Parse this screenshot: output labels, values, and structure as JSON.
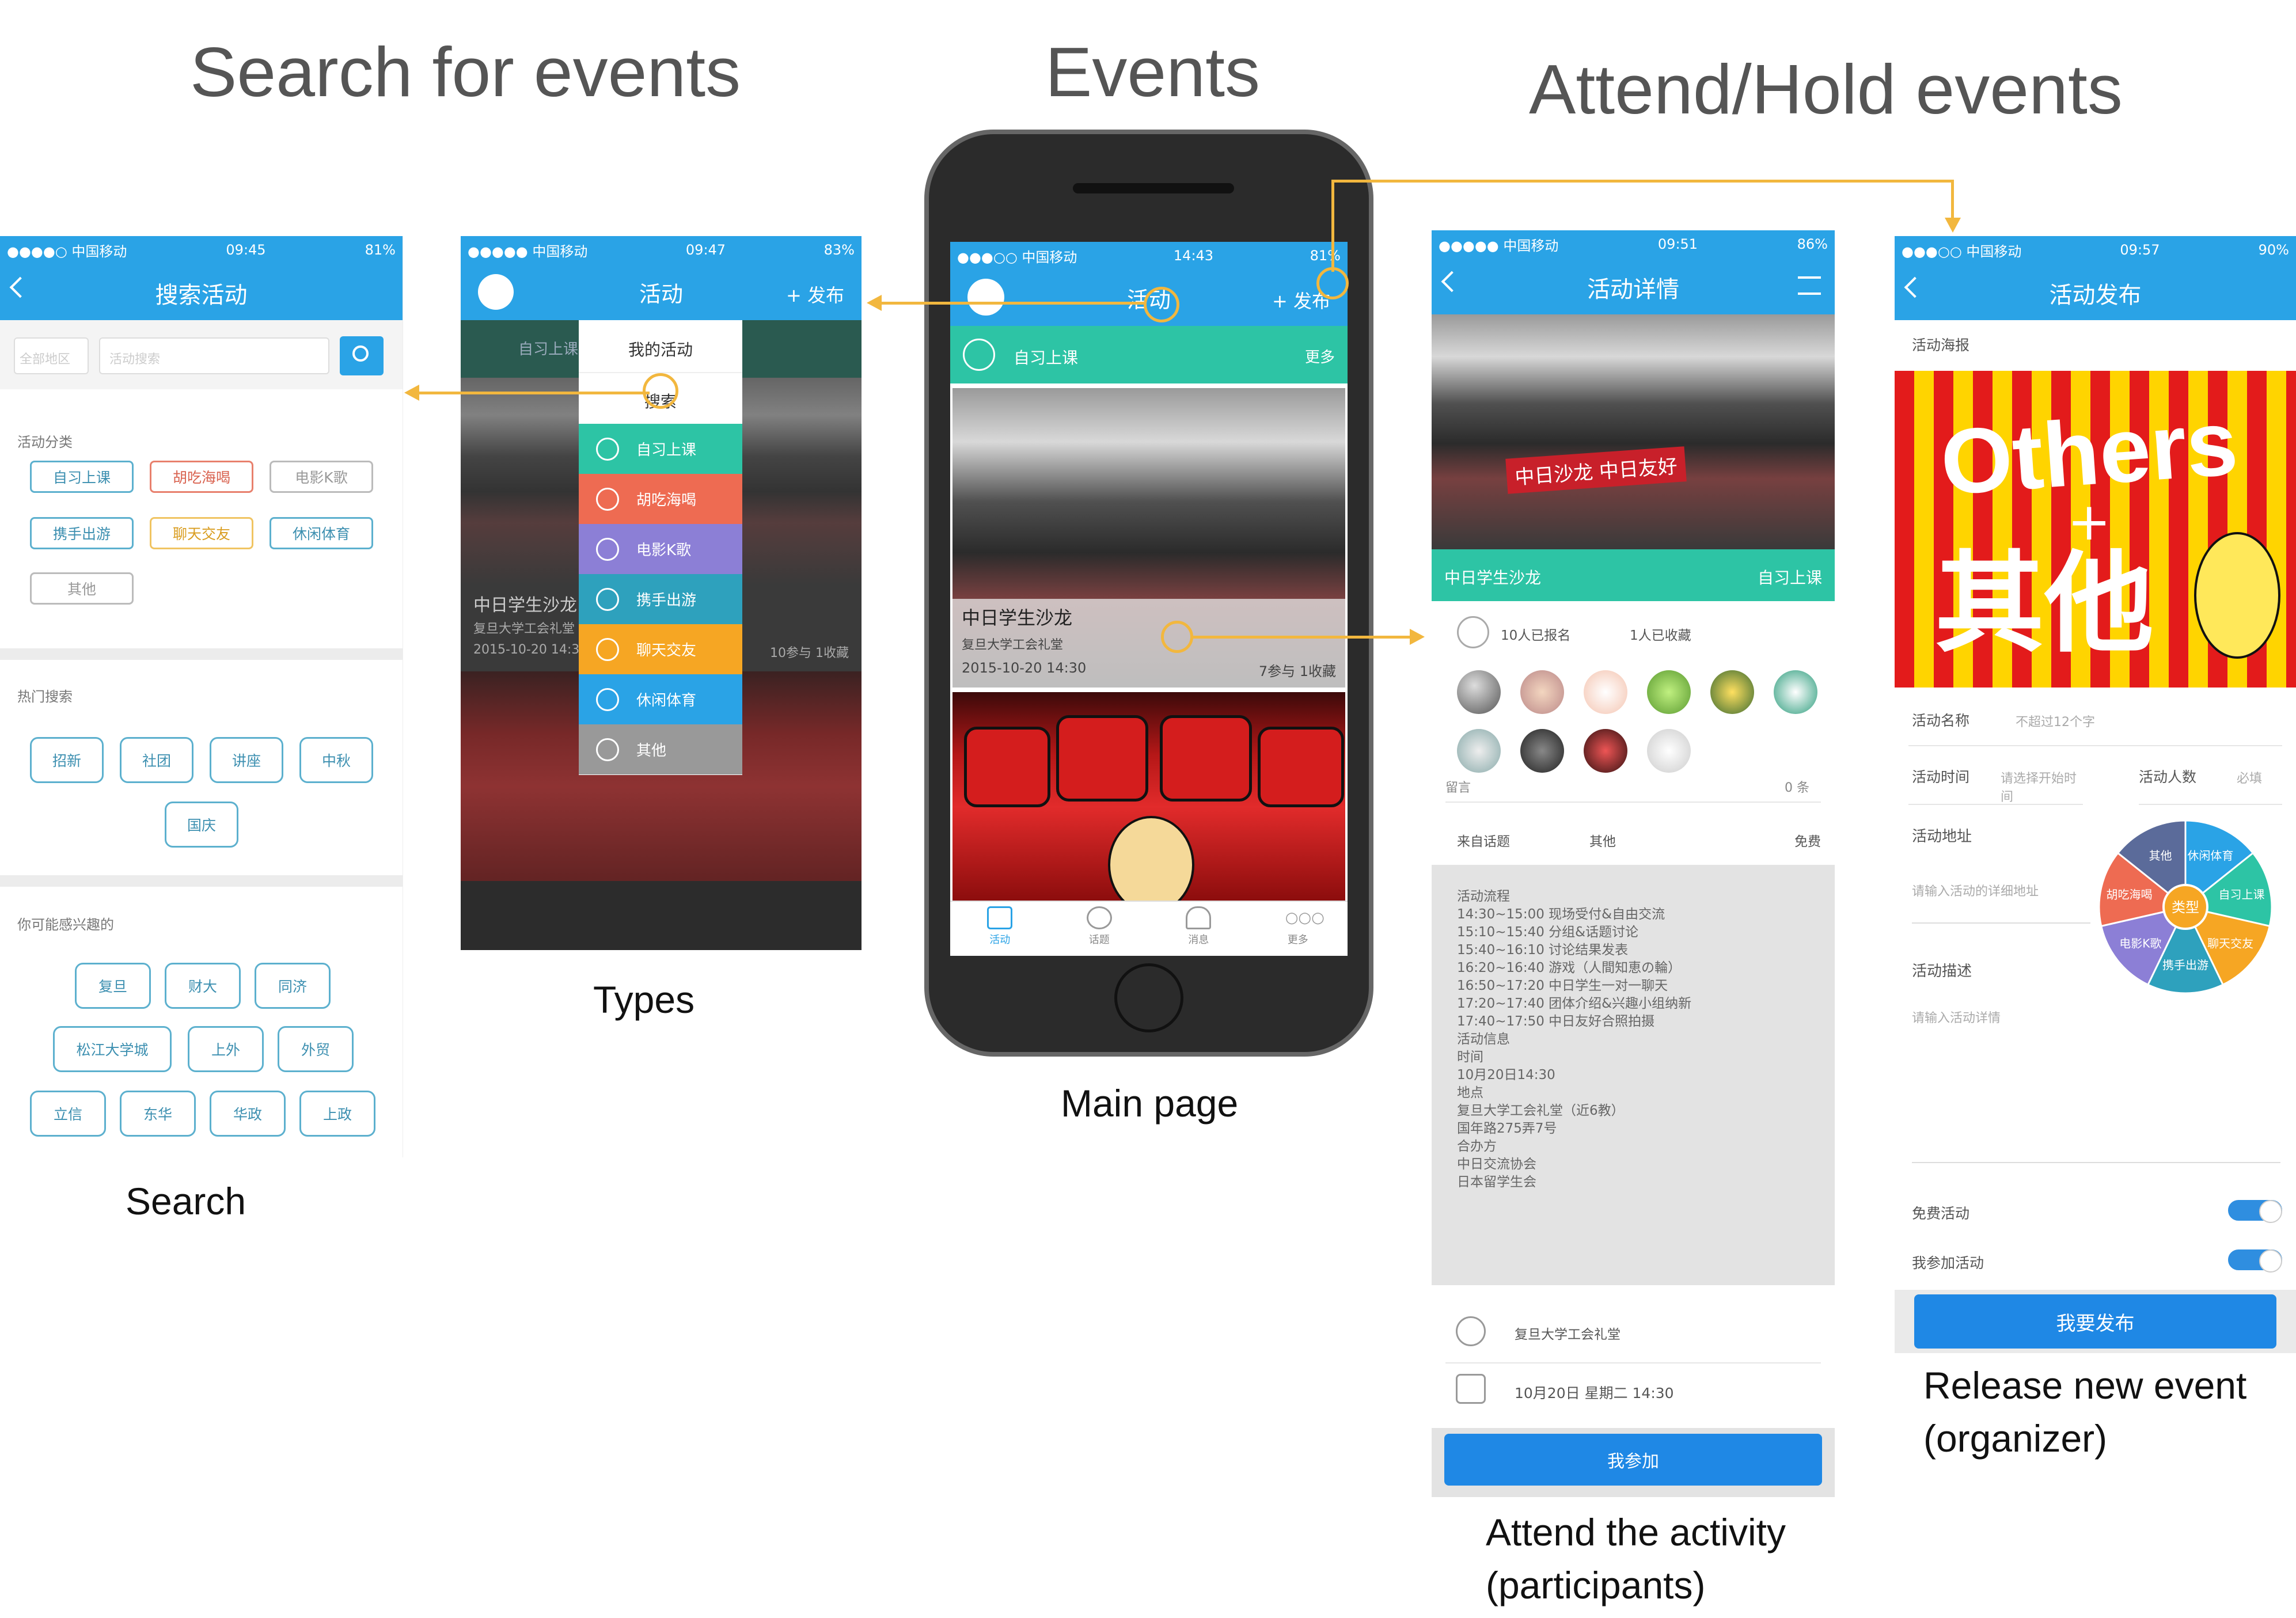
{
  "titles": {
    "search": "Search for events",
    "events": "Events",
    "attend": "Attend/Hold events"
  },
  "captions": {
    "search": "Search",
    "types": "Types",
    "main": "Main page",
    "attend_line1": "Attend the activity",
    "attend_line2": "(participants)",
    "release_line1": "Release new event",
    "release_line2": "(organizer)"
  },
  "colors": {
    "accent": "#2aa3e6",
    "teal": "#2dc4a5",
    "arrow": "#f2b73e"
  },
  "search_screen": {
    "status": {
      "carrier": "●●●●○ 中国移动",
      "time": "09:45",
      "battery": "81%"
    },
    "title": "搜索活动",
    "region_placeholder": "全部地区",
    "search_placeholder": "活动搜索",
    "category_heading": "活动分类",
    "categories": [
      "自习上课",
      "胡吃海喝",
      "电影K歌",
      "携手出游",
      "聊天交友",
      "休闲体育",
      "其他"
    ],
    "hot_heading": "热门搜索",
    "hot": [
      "招新",
      "社团",
      "讲座",
      "中秋",
      "国庆"
    ],
    "interest_heading": "你可能感兴趣的",
    "interest": [
      "复旦",
      "财大",
      "同济",
      "松江大学城",
      "上外",
      "外贸",
      "立信",
      "东华",
      "华政",
      "上政"
    ]
  },
  "types_screen": {
    "status": {
      "carrier": "●●●●● 中国移动",
      "time": "09:47",
      "battery": "83%"
    },
    "title": "活动",
    "publish": "+ 发布",
    "category_bar": "自习上课",
    "more": "更多",
    "menu_header": "我的活动",
    "menu_search": "搜索",
    "menu_items": [
      "自习上课",
      "胡吃海喝",
      "电影K歌",
      "携手出游",
      "聊天交友",
      "休闲体育",
      "其他"
    ],
    "event_title": "中日学生沙龙",
    "event_place": "复旦大学工会礼堂",
    "event_date": "2015-10-20 14:30",
    "event_stats": "10参与   1收藏"
  },
  "main_screen": {
    "status": {
      "carrier": "●●●○○ 中国移动",
      "time": "14:43",
      "battery": "81%"
    },
    "title": "活动",
    "publish": "+ 发布",
    "category_bar": "自习上课",
    "more": "更多",
    "event_title": "中日学生沙龙",
    "event_place": "复旦大学工会礼堂",
    "event_date": "2015-10-20 14:30",
    "event_stats": "7参与   1收藏",
    "tabs": [
      "活动",
      "话题",
      "消息",
      "更多"
    ]
  },
  "detail_screen": {
    "status": {
      "carrier": "●●●●● 中国移动",
      "time": "09:51",
      "battery": "86%"
    },
    "title": "活动详情",
    "banner_title": "中日学生沙龙",
    "banner_tag": "自习上课",
    "photo_banner": "中日沙龙 中日友好",
    "signed": "10人已报名",
    "collected": "1人已收藏",
    "comment_label": "留言",
    "comment_count": "0 条",
    "source_label": "来自话题",
    "source_value": "其他",
    "fee": "免费",
    "description": [
      "活动流程",
      "14:30~15:00 现场受付&自由交流",
      "15:10~15:40 分组&话题讨论",
      "15:40~16:10 讨论结果发表",
      "16:20~16:40 游戏（人間知恵の輪）",
      "16:50~17:20 中日学生一对一聊天",
      "17:20~17:40 团体介绍&兴趣小组纳新",
      "17:40~17:50 中日友好合照拍摄",
      "活动信息",
      "时间",
      "10月20日14:30",
      "地点",
      "复旦大学工会礼堂（近6教）",
      "国年路275弄7号",
      "合办方",
      "中日交流协会",
      "日本留学生会"
    ],
    "location": "复旦大学工会礼堂",
    "datetime": "10月20日  星期二     14:30",
    "join_button": "我参加"
  },
  "publish_screen": {
    "status": {
      "carrier": "●●●○○ 中国移动",
      "time": "09:57",
      "battery": "90%"
    },
    "title": "活动发布",
    "poster_label": "活动海报",
    "poster_text_en": "Others",
    "poster_text_cn": "其他",
    "name_label": "活动名称",
    "name_placeholder": "不超过12个字",
    "time_label": "活动时间",
    "time_placeholder": "请选择开始时间",
    "count_label": "活动人数",
    "count_placeholder": "必填",
    "address_label": "活动地址",
    "address_placeholder": "请输入活动的详细地址",
    "desc_label": "活动描述",
    "desc_placeholder": "请输入活动详情",
    "wheel_center": "类型",
    "wheel_labels": [
      "休闲体育",
      "自习上课",
      "聊天交友",
      "携手出游",
      "电影K歌",
      "胡吃海喝",
      "其他"
    ],
    "free_label": "免费活动",
    "attend_label": "我参加活动",
    "publish_button": "我要发布"
  }
}
